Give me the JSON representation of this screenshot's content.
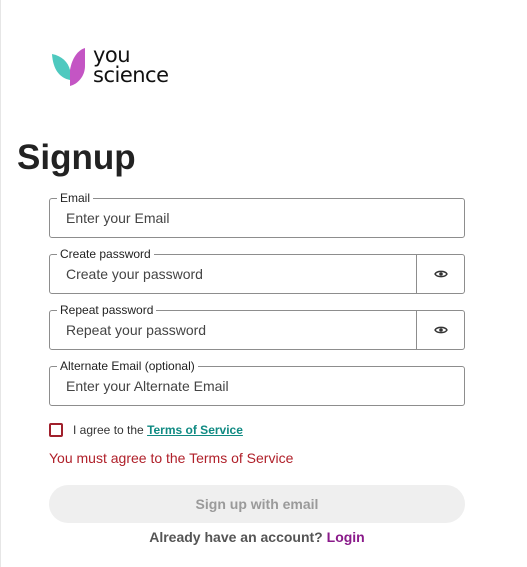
{
  "brand": {
    "word_line1": "you",
    "word_line2": "science",
    "colors": {
      "leaf_teal": "#4ec9bf",
      "leaf_magenta": "#c455c4"
    }
  },
  "page": {
    "title": "Signup"
  },
  "form": {
    "email": {
      "label": "Email",
      "placeholder": "Enter your Email",
      "value": ""
    },
    "create_password": {
      "label": "Create password",
      "placeholder": "Create your password",
      "value": "",
      "toggle_icon": "eye-icon"
    },
    "repeat_password": {
      "label": "Repeat password",
      "placeholder": "Repeat your password",
      "value": "",
      "toggle_icon": "eye-icon"
    },
    "alternate_email": {
      "label": "Alternate Email (optional)",
      "placeholder": "Enter your Alternate Email",
      "value": ""
    },
    "terms": {
      "checked": false,
      "prefix": "I agree to the",
      "link_label": "Terms of Service",
      "error": "You must agree to the Terms of Service"
    },
    "submit_label": "Sign up with email",
    "footer": {
      "prompt": "Already have an account?",
      "login_label": "Login"
    }
  },
  "colors": {
    "error": "#b0202a",
    "link_teal": "#0f8a82",
    "login_link": "#8a1a8a",
    "button_disabled_bg": "#efefef",
    "button_disabled_text": "#9a9a9a"
  }
}
